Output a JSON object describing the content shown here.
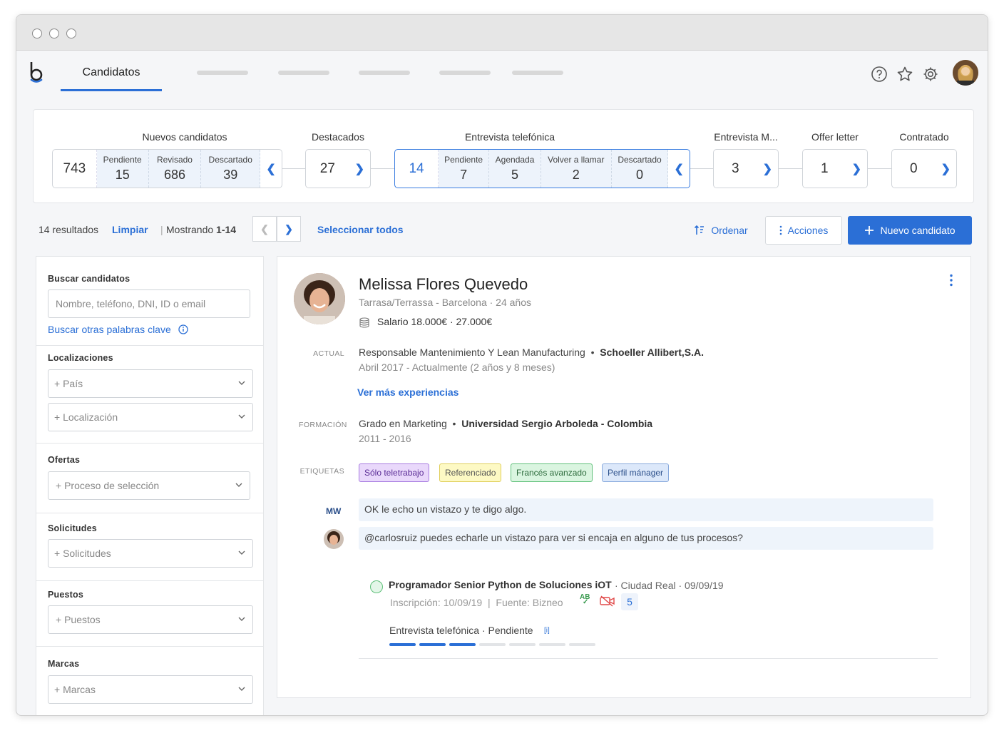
{
  "app": {
    "active_tab": "Candidatos"
  },
  "pipeline": {
    "nuevos": {
      "title": "Nuevos candidatos",
      "total": "743",
      "subs": [
        {
          "label": "Pendiente",
          "value": "15"
        },
        {
          "label": "Revisado",
          "value": "686"
        },
        {
          "label": "Descartado",
          "value": "39"
        }
      ]
    },
    "destacados": {
      "title": "Destacados",
      "total": "27"
    },
    "entrevista_tel": {
      "title": "Entrevista telefónica",
      "total": "14",
      "subs": [
        {
          "label": "Pendiente",
          "value": "7"
        },
        {
          "label": "Agendada",
          "value": "5"
        },
        {
          "label": "Volver a llamar",
          "value": "2"
        },
        {
          "label": "Descartado",
          "value": "0"
        }
      ]
    },
    "entrevista_m": {
      "title": "Entrevista M...",
      "total": "3"
    },
    "offer": {
      "title": "Offer letter",
      "total": "1"
    },
    "contratado": {
      "title": "Contratado",
      "total": "0"
    }
  },
  "results": {
    "count": "14 resultados",
    "clear": "Limpiar",
    "showing_prefix": "Mostrando",
    "showing_range": "1-14",
    "select_all": "Seleccionar todos",
    "sort": "Ordenar",
    "actions": "Acciones",
    "new_candidate": "Nuevo candidato"
  },
  "filters": {
    "search": {
      "label": "Buscar candidatos",
      "placeholder": "Nombre, teléfono, DNI, ID o email",
      "more": "Buscar otras palabras clave"
    },
    "locations": {
      "label": "Localizaciones",
      "country": "+ País",
      "location": "+ Localización"
    },
    "offers": {
      "label": "Ofertas",
      "process": "+ Proceso de selección"
    },
    "requests": {
      "label": "Solicitudes",
      "value": "+ Solicitudes"
    },
    "positions": {
      "label": "Puestos",
      "value": "+ Puestos"
    },
    "brands": {
      "label": "Marcas",
      "value": "+ Marcas"
    }
  },
  "candidate": {
    "name": "Melissa Flores Quevedo",
    "location": "Tarrasa/Terrassa - Barcelona · 24 años",
    "salary": "Salario 18.000€ · 27.000€",
    "current_label": "ACTUAL",
    "current_role": "Responsable Mantenimiento Y Lean Manufacturing",
    "current_company": "Schoeller Allibert,S.A.",
    "current_dates": "Abril 2017 - Actualmente (2 años y 8 meses)",
    "more_exp": "Ver más experiencias",
    "edu_label": "FORMACIÓN",
    "edu_title": "Grado en Marketing",
    "edu_school": "Universidad Sergio Arboleda - Colombia",
    "edu_dates": "2011 - 2016",
    "tags_label": "ETIQUETAS",
    "tags": [
      {
        "text": "Sólo teletrabajo",
        "color": "#e9d8fb",
        "border": "#a77be0",
        "fg": "#5a2c96"
      },
      {
        "text": "Referenciado",
        "color": "#fdf9c4",
        "border": "#e0cf5a",
        "fg": "#555"
      },
      {
        "text": "Francés avanzado",
        "color": "#daf5e0",
        "border": "#5fc07a",
        "fg": "#2d6b3c"
      },
      {
        "text": "Perfil mánager",
        "color": "#dce8fa",
        "border": "#88a9dc",
        "fg": "#2b4f8a"
      }
    ],
    "comments": [
      {
        "initials": "MW",
        "text": "OK le echo un vistazo y te digo algo."
      },
      {
        "text": "@carlosruiz puedes echarle un vistazo para ver si encaja en alguno de tus procesos?"
      }
    ],
    "application": {
      "title": "Programador Senior Python de Soluciones iOT",
      "meta": "· Ciudad Real · 09/09/19",
      "inscription": "Inscripción: 10/09/19",
      "source": "Fuente: Bizneo",
      "ab": "AB",
      "count": "5",
      "status": "Entrevista telefónica · Pendiente",
      "info": "[i]",
      "progress_done": 3,
      "progress_total": 7
    }
  },
  "colors": {
    "accent": "#2b6fd6"
  }
}
